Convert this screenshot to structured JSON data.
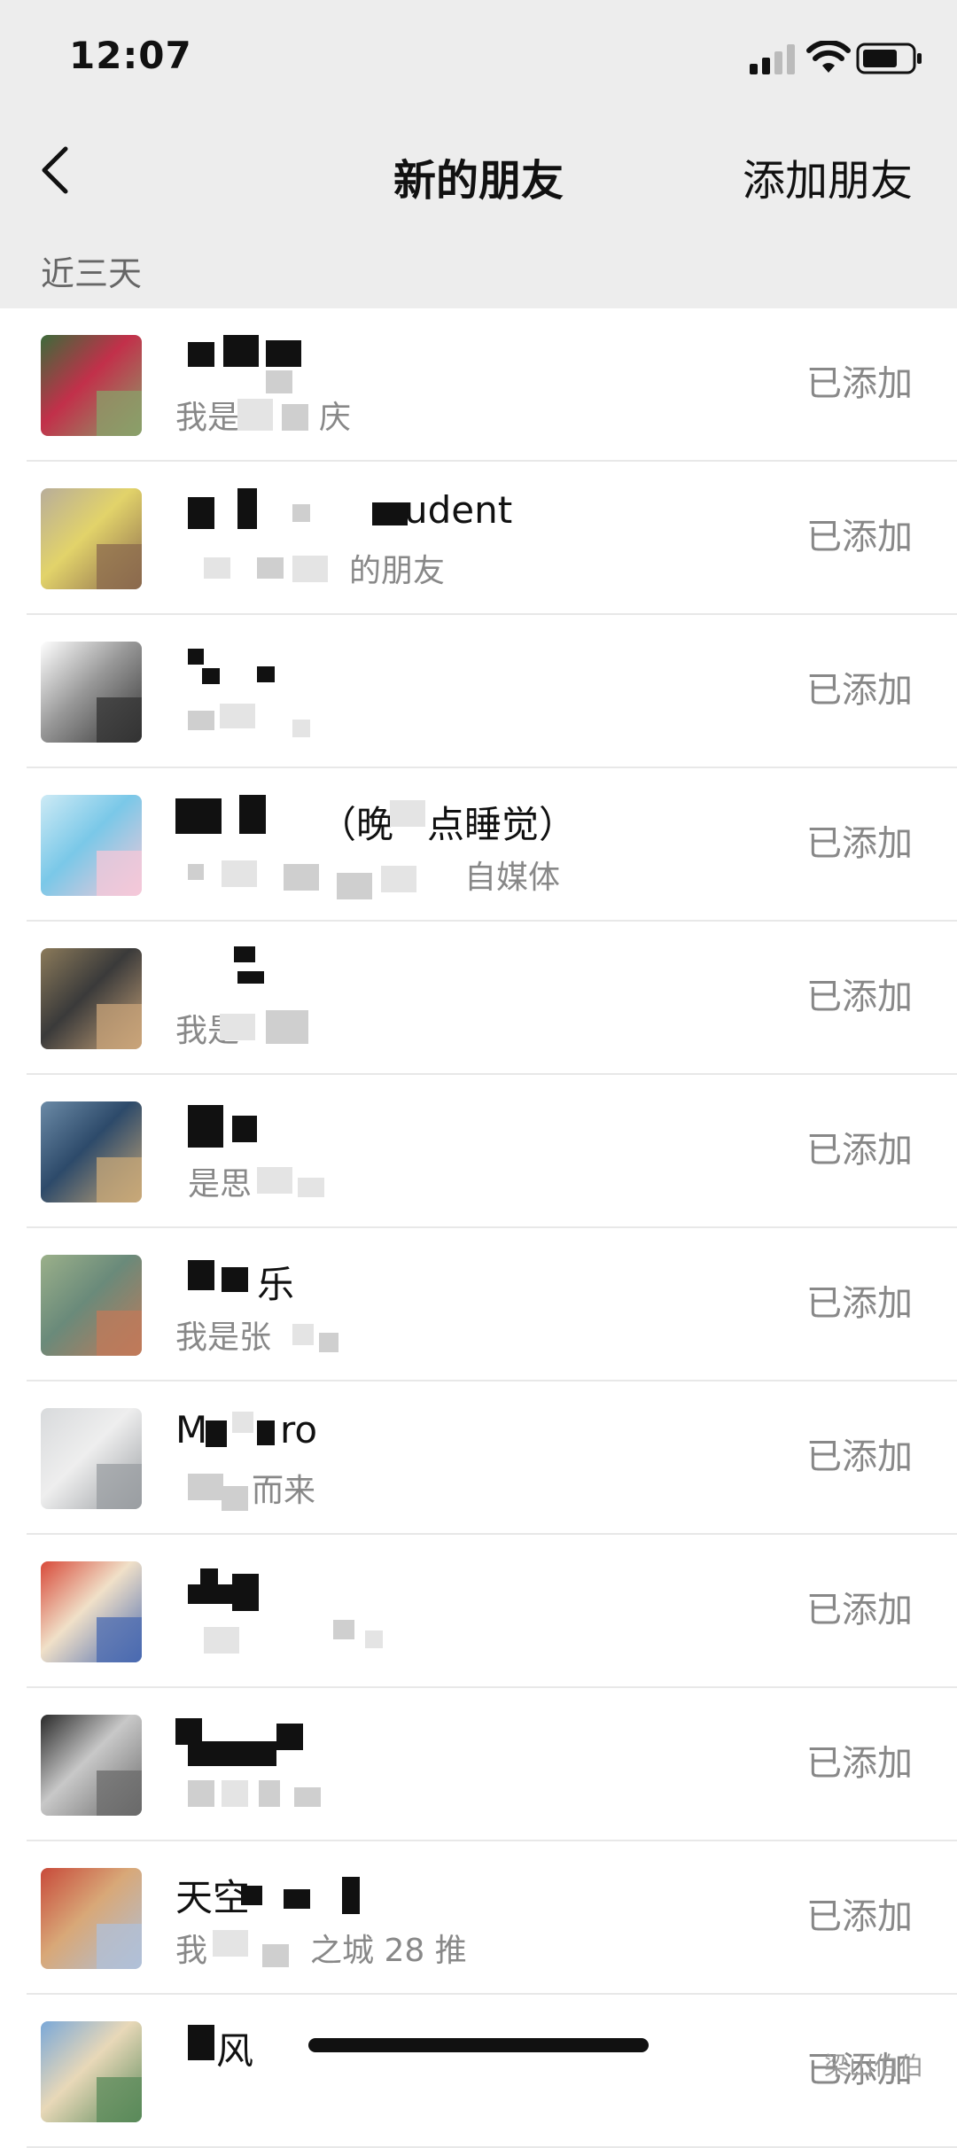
{
  "status_bar": {
    "time": "12:07"
  },
  "nav": {
    "title": "新的朋友",
    "add_friend": "添加朋友"
  },
  "section": {
    "label": "近三天"
  },
  "rows": [
    {
      "name": "",
      "sub": "我是",
      "sub2": "庆",
      "status": "已添加",
      "avatar_colors": [
        "#3c6b3a",
        "#8aa06a",
        "#c2304a"
      ]
    },
    {
      "name": "",
      "name2": "udent",
      "sub": "",
      "sub2": "的朋友",
      "status": "已添加",
      "avatar_colors": [
        "#b8ad9a",
        "#8b6a4e",
        "#e2d36a"
      ]
    },
    {
      "name": "",
      "sub": "",
      "status": "已添加",
      "avatar_colors": [
        "#ffffff",
        "#333333",
        "#999999"
      ]
    },
    {
      "name": "",
      "name2": "（晚",
      "name3": "点睡觉）",
      "sub": "",
      "sub2": "自媒体",
      "status": "已添加",
      "avatar_colors": [
        "#cdeaf5",
        "#f5c8d8",
        "#7ac8e8"
      ]
    },
    {
      "name": "",
      "sub": "我是",
      "status": "已添加",
      "avatar_colors": [
        "#8b7a5a",
        "#c9a47a",
        "#3a3a3a"
      ]
    },
    {
      "name": "",
      "sub": "是思",
      "status": "已添加",
      "avatar_colors": [
        "#6b8aa6",
        "#c8a878",
        "#2d4a6a"
      ]
    },
    {
      "name": "",
      "name2": "乐",
      "sub": "我是张",
      "status": "已添加",
      "avatar_colors": [
        "#9bb08a",
        "#c07a5a",
        "#6a8a7a"
      ]
    },
    {
      "name": "M",
      "name2": "ro",
      "sub": "",
      "sub2": "而来",
      "status": "已添加",
      "avatar_colors": [
        "#d8dadc",
        "#9a9ea2",
        "#eeeeee"
      ]
    },
    {
      "name": "",
      "sub": "",
      "status": "已添加",
      "avatar_colors": [
        "#d84a3a",
        "#4a6ab0",
        "#f0e0c8"
      ]
    },
    {
      "name": "",
      "sub": "",
      "status": "已添加",
      "avatar_colors": [
        "#2a2a2a",
        "#6a6a6a",
        "#c8c8c8"
      ]
    },
    {
      "name": "",
      "name2": "天空",
      "sub": "我",
      "sub2": "之城 28 推",
      "status": "已添加",
      "avatar_colors": [
        "#c84a3a",
        "#b0c0d8",
        "#d8a878"
      ]
    },
    {
      "name": "",
      "name2": "风",
      "sub": "",
      "status": "已添加",
      "avatar_colors": [
        "#7aa8d8",
        "#5a8a5a",
        "#e8d8b8"
      ]
    }
  ],
  "watermark": "梁山伯伯"
}
